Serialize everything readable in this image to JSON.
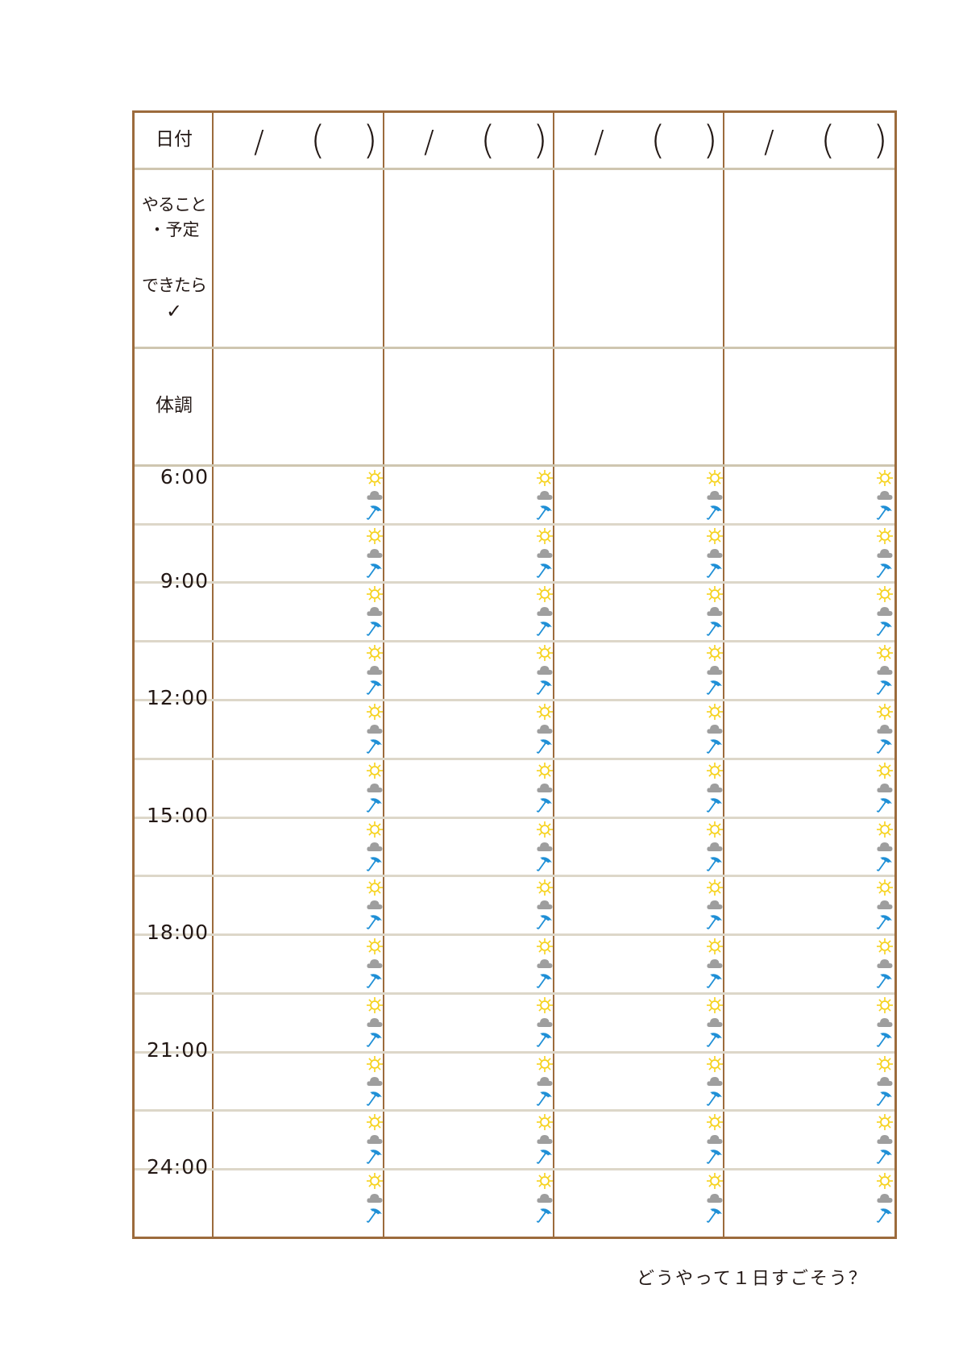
{
  "header": {
    "date_label": "日付",
    "date_slash": "/",
    "paren_open": "(",
    "paren_close": ")"
  },
  "rows": {
    "todo_label_1": "やること",
    "todo_label_2": "・予定",
    "done_label": "できたら",
    "check_mark": "✓",
    "condition_label": "体調"
  },
  "times": [
    "6:00",
    "9:00",
    "12:00",
    "15:00",
    "18:00",
    "21:00",
    "24:00"
  ],
  "weather_icons": [
    "sun-icon",
    "cloud-icon",
    "umbrella-icon"
  ],
  "colors": {
    "border": "#9c6b3c",
    "sun": "#f6d21c",
    "cloud": "#9e9e9e",
    "umbrella": "#1e8fd6"
  },
  "footer": "どうやって１日すごそう？"
}
